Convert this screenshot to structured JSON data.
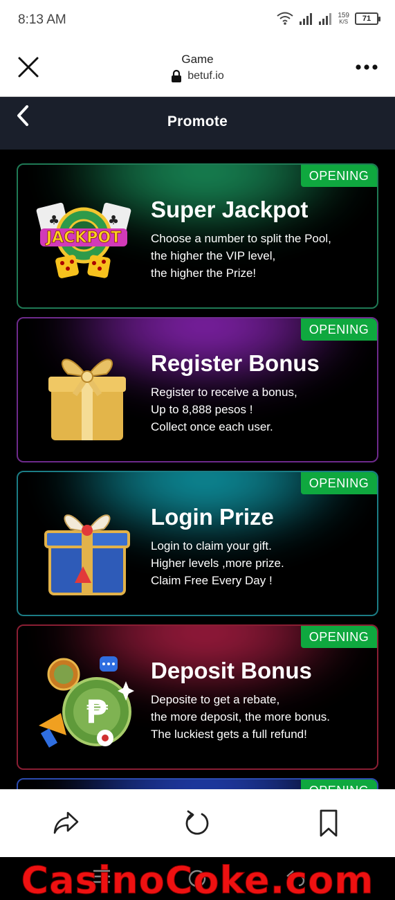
{
  "status": {
    "time": "8:13 AM",
    "speed_value": "159",
    "speed_unit": "K/S",
    "battery": "71"
  },
  "browser": {
    "page_name": "Game",
    "domain": "betuf.io"
  },
  "nav": {
    "title": "Promote"
  },
  "promos": [
    {
      "badge": "OPENING",
      "title": "Super Jackpot",
      "lines": [
        "Choose a number to split the Pool,",
        "the higher the VIP level,",
        "the higher the Prize!"
      ],
      "art_text": "JACKPOT",
      "glow_color": "#1fae6e",
      "border_color": "#1f7a55"
    },
    {
      "badge": "OPENING",
      "title": "Register Bonus",
      "lines": [
        "Register  to receive a bonus,",
        "Up to 8,888 pesos !",
        "Collect once each user."
      ],
      "glow_color": "#a42bd8",
      "border_color": "#6e2a8c"
    },
    {
      "badge": "OPENING",
      "title": "Login Prize",
      "lines": [
        "Login to claim your gift.",
        "Higher levels ,more prize.",
        "Claim Free Every Day !"
      ],
      "glow_color": "#12b7c9",
      "border_color": "#1b7d85"
    },
    {
      "badge": "OPENING",
      "title": "Deposit Bonus",
      "lines": [
        "Deposite to get a rebate,",
        "the more deposit, the more bonus.",
        "The luckiest gets a full refund!"
      ],
      "art_symbol": "₱",
      "glow_color": "#c8234f",
      "border_color": "#8a1e33"
    },
    {
      "badge": "OPENING",
      "glow_color": "#2a4fe0",
      "border_color": "#2c4bb0"
    }
  ],
  "watermark": "CasinoCoke.com",
  "icons": [
    "wifi-icon",
    "signal-icon",
    "close-icon",
    "lock-icon",
    "more-icon",
    "back-icon",
    "share-icon",
    "refresh-icon",
    "bookmark-icon"
  ]
}
